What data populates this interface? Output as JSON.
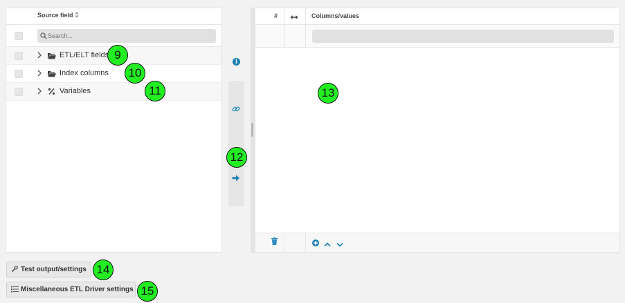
{
  "source_panel": {
    "column_header": "Source field",
    "sort_icon": "sort-icon",
    "search_placeholder": "Search...",
    "items": [
      {
        "label": "ETL/ELT fields",
        "icon": "folder-open-icon"
      },
      {
        "label": "Index columns",
        "icon": "folder-open-icon"
      },
      {
        "label": "Variables",
        "icon": "percent-icon"
      }
    ]
  },
  "middle": {
    "info_icon": "i",
    "link_icon": "link-icon",
    "arrow_icon": "arrow-right-icon"
  },
  "target_panel": {
    "col_index": "#",
    "col_swap_icon": "swap-horizontal-icon",
    "col_values": "Columns/values",
    "footer_icons": [
      "trash-icon",
      "add-circle-icon",
      "chevron-up-icon",
      "chevron-down-icon"
    ]
  },
  "buttons": {
    "test_output": "Test output/settings",
    "misc_settings": "Miscellaneous ETL Driver settings"
  },
  "markers": [
    "9",
    "10",
    "11",
    "12",
    "13",
    "14",
    "15"
  ],
  "colors": {
    "accent": "#1f7fb0",
    "marker": "#22ee22"
  }
}
